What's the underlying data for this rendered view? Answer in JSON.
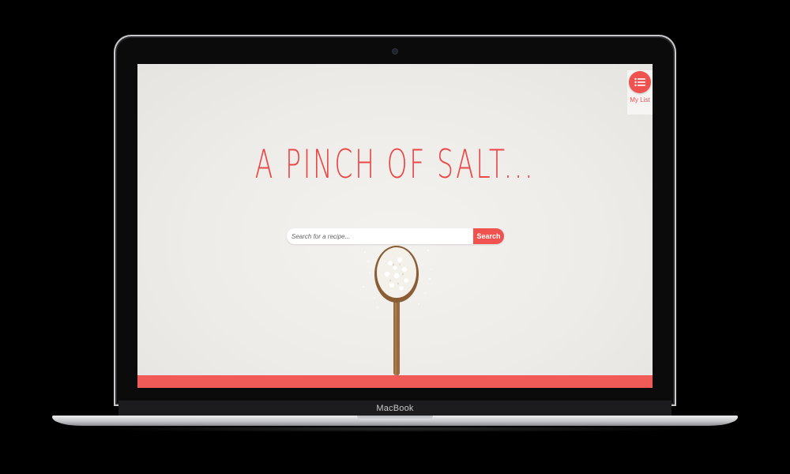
{
  "device": {
    "brand_label": "MacBook"
  },
  "app": {
    "title": "A PINCH OF SALT...",
    "my_list": {
      "label": "My List",
      "icon": "list-icon"
    },
    "search": {
      "placeholder": "Search for a recipe...",
      "button_label": "Search"
    },
    "colors": {
      "accent": "#f0524f",
      "background": "#efeeea",
      "footer": "#f05b57"
    }
  }
}
